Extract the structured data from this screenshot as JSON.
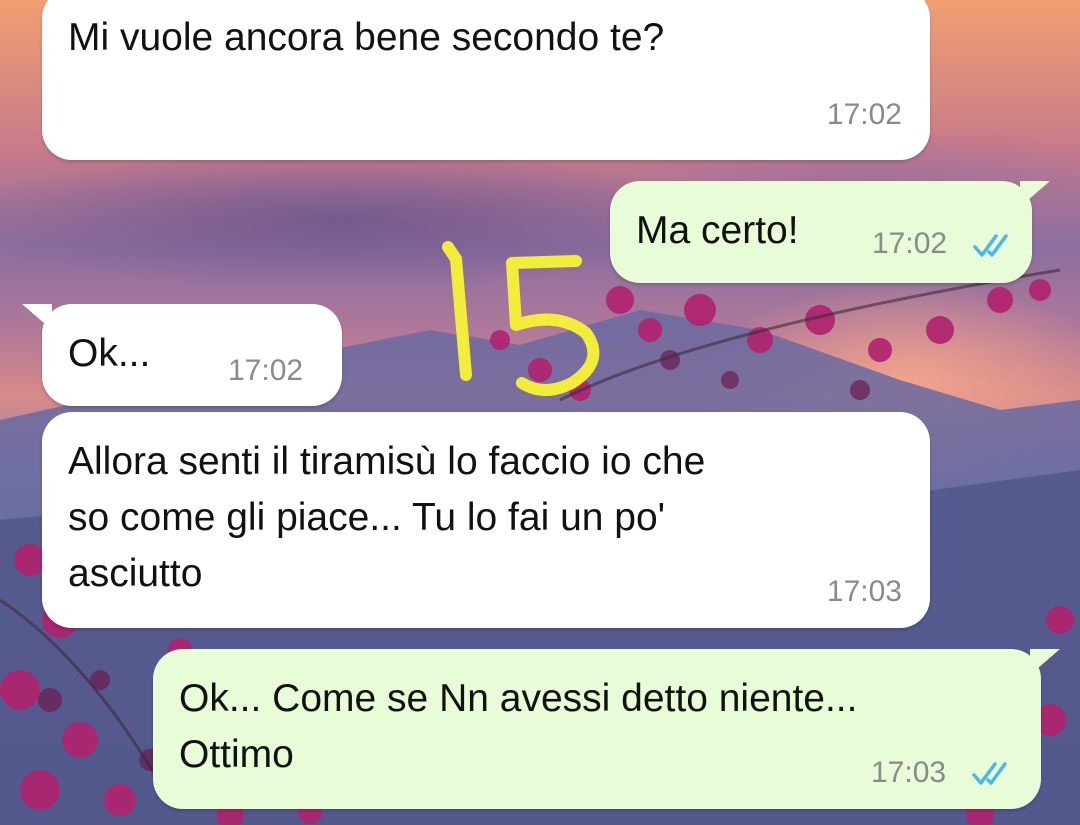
{
  "messages": [
    {
      "direction": "incoming",
      "text": "Mi vuole ancora bene secondo te?",
      "time": "17:02"
    },
    {
      "direction": "outgoing",
      "text": "Ma certo!",
      "time": "17:02",
      "status": "read"
    },
    {
      "direction": "incoming",
      "text": "Ok...",
      "time": "17:02"
    },
    {
      "direction": "incoming",
      "text": "Allora senti il tiramisù lo faccio io che\nso come gli piace... Tu lo fai un po'\nasciutto",
      "time": "17:03"
    },
    {
      "direction": "outgoing",
      "text": "Ok... Come se Nn avessi detto niente...\nOttimo",
      "time": "17:03",
      "status": "read"
    }
  ],
  "annotation": {
    "text": "15",
    "color": "#f2ec3a"
  },
  "colors": {
    "incoming_bubble": "#ffffff",
    "outgoing_bubble": "#e7fcd7",
    "read_ticks": "#4fb6ec",
    "timestamp": "#8a8a8a"
  },
  "icons": {
    "read_receipt": "double-check-icon"
  }
}
